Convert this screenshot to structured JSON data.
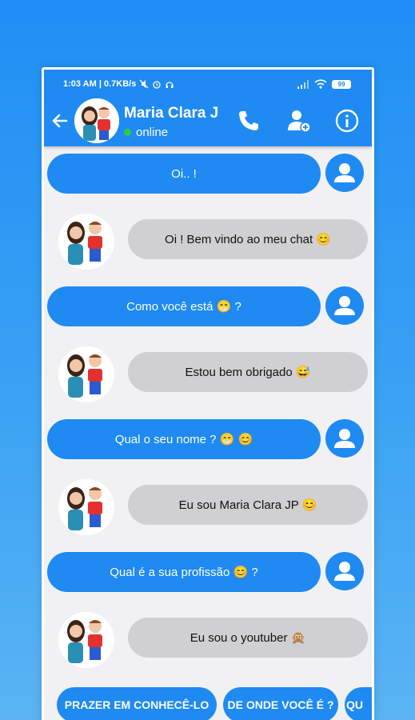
{
  "status_bar": {
    "time_speed": "1:03 AM | 0.7KB/s",
    "battery": "99"
  },
  "header": {
    "contact_name": "Maria Clara J",
    "presence": "online"
  },
  "icons": {
    "back": "arrow-left-icon",
    "call": "phone-icon",
    "add_contact": "add-user-icon",
    "info": "info-icon",
    "user": "user-icon"
  },
  "colors": {
    "primary": "#1e8af2",
    "received_bubble": "#d0d0d2",
    "online_dot": "#2ecc40"
  },
  "messages": [
    {
      "side": "sent",
      "text": "Oi.. !"
    },
    {
      "side": "received",
      "text": "Oi ! Bem vindo ao meu chat 😊"
    },
    {
      "side": "sent",
      "text": "Como você está 😁 ?"
    },
    {
      "side": "received",
      "text": "Estou bem obrigado 😅"
    },
    {
      "side": "sent",
      "text": "Qual o seu nome ? 😁 😊"
    },
    {
      "side": "received",
      "text": "Eu sou Maria Clara JP 😊"
    },
    {
      "side": "sent",
      "text": "Qual é a sua profissão 😊 ?"
    },
    {
      "side": "received",
      "text": "Eu sou o youtuber 🙊"
    }
  ],
  "quick_replies": [
    "PRAZER EM CONHECÊ-LO",
    "DE ONDE VOCÊ É ?",
    "QU"
  ]
}
